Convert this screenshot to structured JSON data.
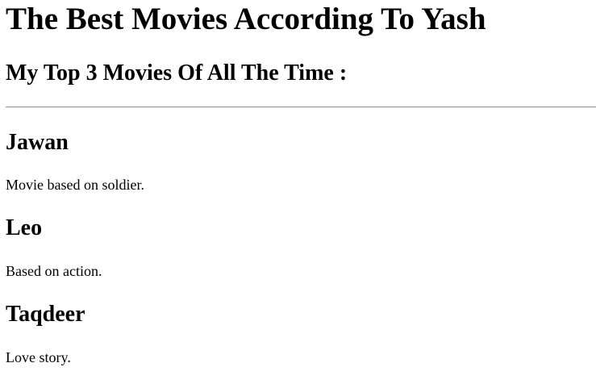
{
  "page": {
    "title": "The Best Movies According To Yash",
    "subtitle": "My Top 3 Movies Of All The Time :"
  },
  "movies": [
    {
      "title": "Jawan",
      "description": "Movie based on soldier."
    },
    {
      "title": "Leo",
      "description": "Based on action."
    },
    {
      "title": "Taqdeer",
      "description": "Love story."
    }
  ]
}
